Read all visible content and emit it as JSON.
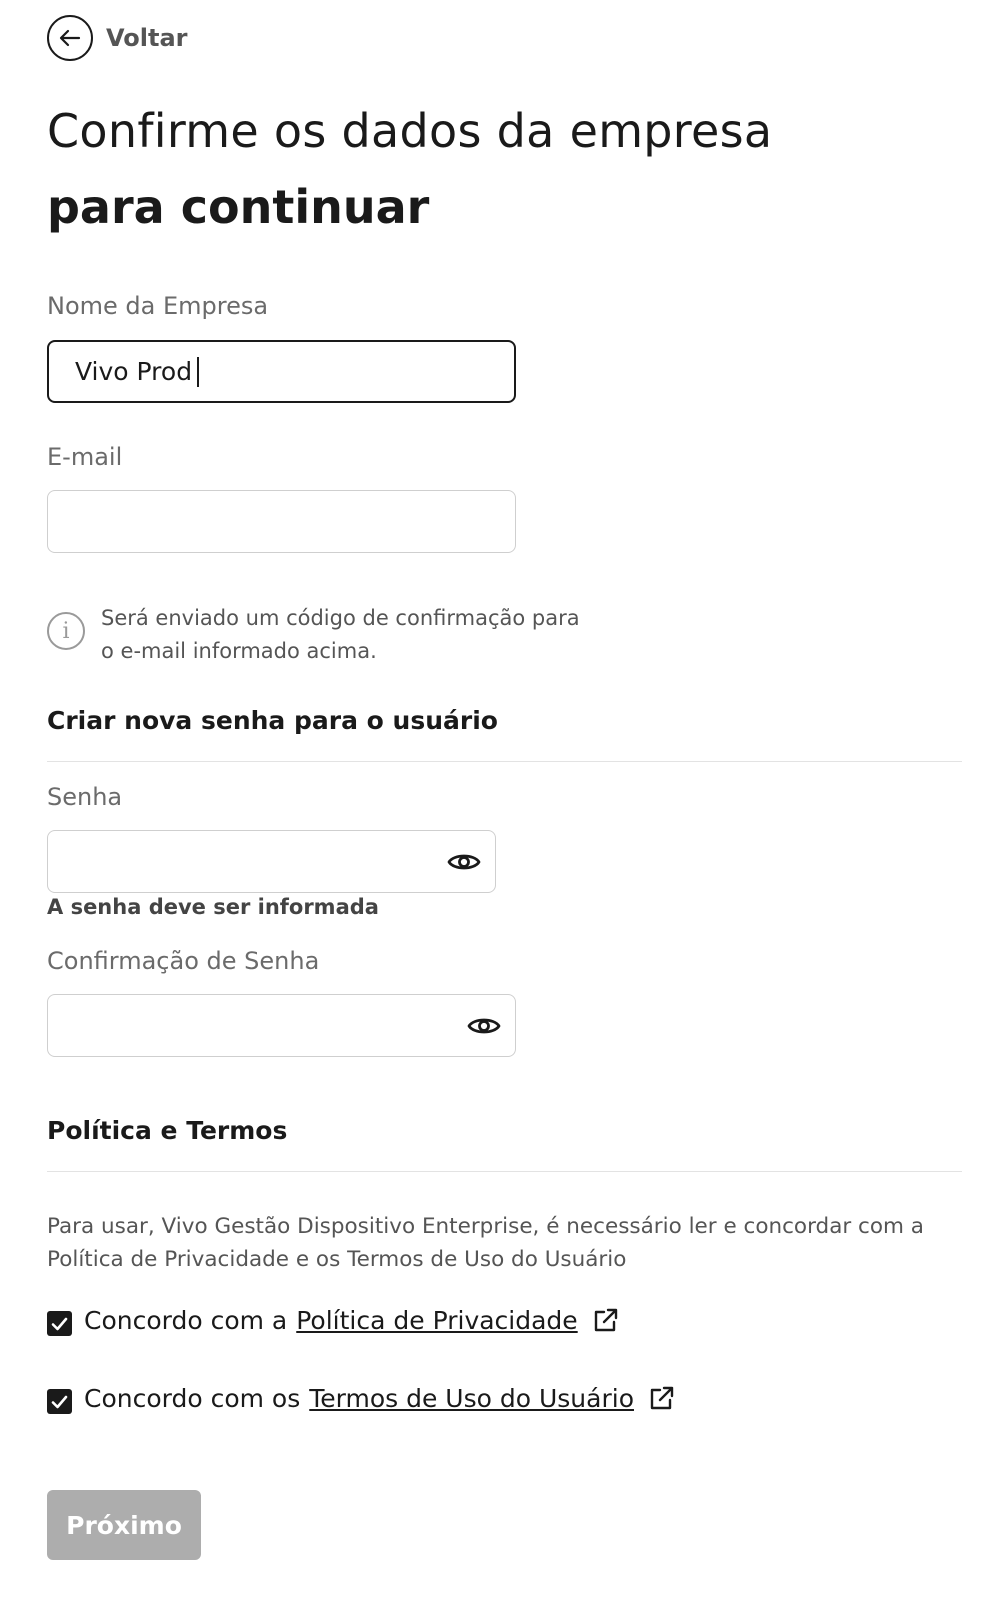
{
  "back": {
    "label": "Voltar"
  },
  "title": {
    "line1": "Confirme os dados da empresa",
    "line2": "para continuar"
  },
  "company": {
    "label": "Nome da Empresa",
    "value": "Vivo Prod"
  },
  "email": {
    "label": "E-mail",
    "value": ""
  },
  "info": {
    "text": "Será enviado um código de confirmação para o e-mail informado acima."
  },
  "password_section": {
    "title": "Criar nova senha para o usuário",
    "password_label": "Senha",
    "password_error": "A senha deve ser informada",
    "confirm_label": "Confirmação de Senha"
  },
  "terms_section": {
    "title": "Política e Termos",
    "description": "Para usar, Vivo Gestão Dispositivo Enterprise, é necessário ler e concordar com a Política de Privacidade e os Termos de Uso do Usuário",
    "privacy": {
      "prefix": "Concordo com a",
      "link": "Política de Privacidade",
      "checked": true
    },
    "terms": {
      "prefix": "Concordo com os",
      "link": "Termos de Uso do Usuário",
      "checked": true
    }
  },
  "next_button": {
    "label": "Próximo",
    "enabled": false
  },
  "colors": {
    "text": "#1a1a1a",
    "muted": "#6b6b6b",
    "border": "#cfcfcf",
    "button_disabled": "#adadad"
  }
}
